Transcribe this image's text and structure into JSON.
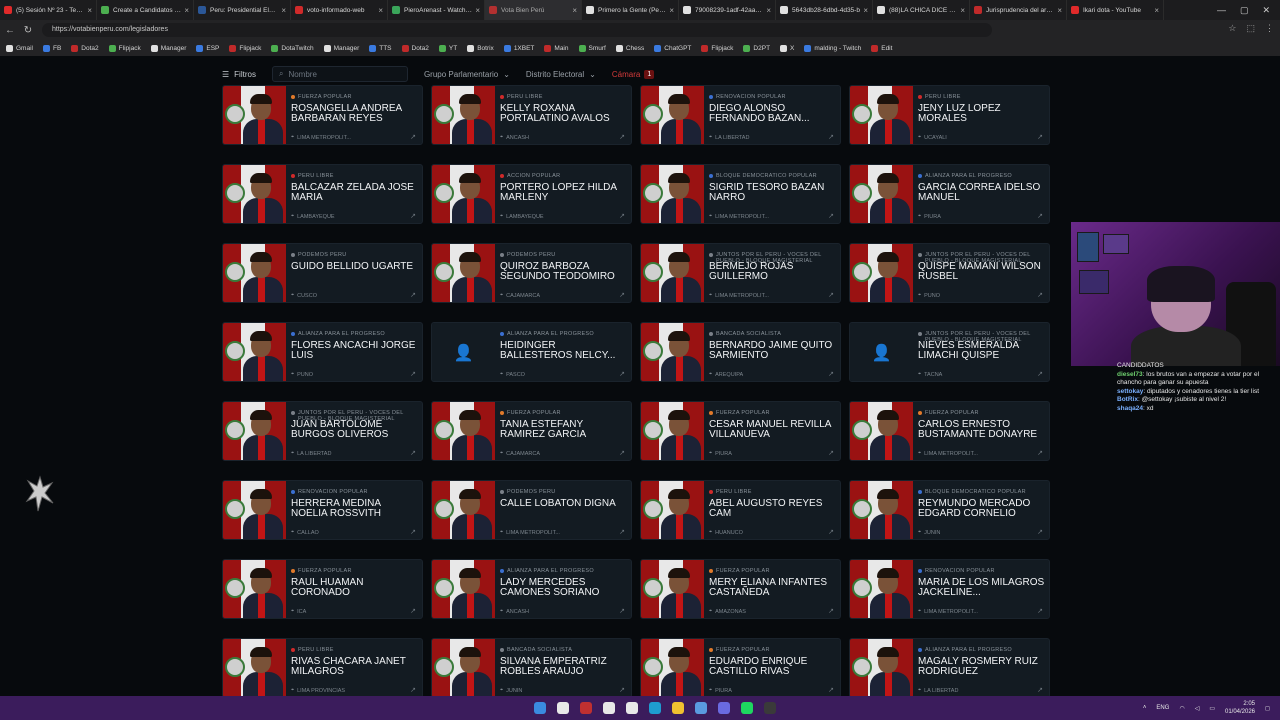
{
  "browser": {
    "tabs": [
      {
        "title": "(5) Sesión Nº 23 - Testimo",
        "color": "#e02a2a"
      },
      {
        "title": "Create a Candidatos Per...",
        "color": "#4caf50"
      },
      {
        "title": "Peru: Presidential Electio",
        "color": "#2b5797"
      },
      {
        "title": "voto-informado-web",
        "color": "#d02a2a"
      },
      {
        "title": "PieroArenast - Watch the",
        "color": "#3aa55a"
      },
      {
        "title": "Vota Bien Perú",
        "color": "#b23030",
        "active": true
      },
      {
        "title": "Primero la Gente (Perú) -",
        "color": "#e0e0e0"
      },
      {
        "title": "79008239-1adf-42aa-aa6",
        "color": "#e0e0e0"
      },
      {
        "title": "5643db28-6dbd-4d35-b",
        "color": "#e0e0e0"
      },
      {
        "title": "(88)LA CHICA DICE QUE",
        "color": "#e0e0e0"
      },
      {
        "title": "Jurisprudencia del artícul",
        "color": "#c02a2a"
      },
      {
        "title": "Ikari dota - YouTube",
        "color": "#e02a2a"
      }
    ],
    "url": "https://votabienperu.com/legisladores",
    "bookmarks": [
      "Gmail",
      "FB",
      "Dota2",
      "Flipjack",
      "Manager",
      "ESP",
      "Flipjack",
      "DotaTwitch",
      "Manager",
      "TTS",
      "Dota2",
      "YT",
      "Botrix",
      "1XBET",
      "Main",
      "Smurf",
      "Chess",
      "ChatGPT",
      "Flipjack",
      "D2PT",
      "X",
      "malding - Twitch",
      "Edit"
    ]
  },
  "filters": {
    "filter_label": "Filtros",
    "search_placeholder": "Nombre",
    "group_label": "Grupo Parlamentario",
    "district_label": "Distrito Electoral",
    "chamber_label": "Cámara",
    "chamber_count": "1"
  },
  "cards": [
    {
      "party": "FUERZA POPULAR",
      "name": "ROSANGELLA ANDREA BARBARAN REYES",
      "region": "LIMA METROPOLIT...",
      "color": "#e07a2a",
      "photo": true
    },
    {
      "party": "PERU LIBRE",
      "name": "KELLY ROXANA PORTALATINO AVALOS",
      "region": "ANCASH",
      "color": "#d02a2a",
      "photo": true
    },
    {
      "party": "RENOVACION POPULAR",
      "name": "DIEGO ALONSO FERNANDO BAZAN...",
      "region": "LA LIBERTAD",
      "color": "#3a6fd0",
      "photo": true
    },
    {
      "party": "PERU LIBRE",
      "name": "JENY LUZ LOPEZ MORALES",
      "region": "UCAYALI",
      "color": "#d02a2a",
      "photo": true
    },
    {
      "party": "PERU LIBRE",
      "name": "BALCAZAR ZELADA JOSE MARIA",
      "region": "LAMBAYEQUE",
      "color": "#d02a2a",
      "photo": true
    },
    {
      "party": "ACCION POPULAR",
      "name": "PORTERO LOPEZ HILDA MARLENY",
      "region": "LAMBAYEQUE",
      "color": "#d02a2a",
      "photo": true
    },
    {
      "party": "BLOQUE DEMOCRATICO POPULAR",
      "name": "SIGRID TESORO BAZAN NARRO",
      "region": "LIMA METROPOLIT...",
      "color": "#3a6fd0",
      "photo": true
    },
    {
      "party": "ALIANZA PARA EL PROGRESO",
      "name": "GARCIA CORREA IDELSO MANUEL",
      "region": "PIURA",
      "color": "#3a6fd0",
      "photo": true
    },
    {
      "party": "PODEMOS PERU",
      "name": "GUIDO BELLIDO UGARTE",
      "region": "CUSCO",
      "color": "#7a8088",
      "photo": true
    },
    {
      "party": "PODEMOS PERU",
      "name": "QUIROZ BARBOZA SEGUNDO TEODOMIRO",
      "region": "CAJAMARCA",
      "color": "#7a8088",
      "photo": true
    },
    {
      "party": "JUNTOS POR EL PERU - VOCES DEL PUEBLO - BLOQUE MAGISTERIAL",
      "name": "BERMEJO ROJAS GUILLERMO",
      "region": "LIMA METROPOLIT...",
      "color": "#7a8088",
      "photo": true
    },
    {
      "party": "JUNTOS POR EL PERU - VOCES DEL PUEBLO - BLOQUE MAGISTERIAL",
      "name": "QUISPE MAMANI WILSON RUSBEL",
      "region": "PUNO",
      "color": "#7a8088",
      "photo": true
    },
    {
      "party": "ALIANZA PARA EL PROGRESO",
      "name": "FLORES ANCACHI JORGE LUIS",
      "region": "PUNO",
      "color": "#3a6fd0",
      "photo": true
    },
    {
      "party": "ALIANZA PARA EL PROGRESO",
      "name": "HEIDINGER BALLESTEROS NELCY...",
      "region": "PASCO",
      "color": "#3a6fd0",
      "photo": false
    },
    {
      "party": "BANCADA SOCIALISTA",
      "name": "BERNARDO JAIME QUITO SARMIENTO",
      "region": "AREQUIPA",
      "color": "#7a8088",
      "photo": true
    },
    {
      "party": "JUNTOS POR EL PERU - VOCES DEL PUEBLO - BLOQUE MAGISTERIAL",
      "name": "NIEVES ESMERALDA LIMACHI QUISPE",
      "region": "TACNA",
      "color": "#7a8088",
      "photo": false
    },
    {
      "party": "JUNTOS POR EL PERU - VOCES DEL PUEBLO - BLOQUE MAGISTERIAL",
      "name": "JUAN BARTOLOME BURGOS OLIVEROS",
      "region": "LA LIBERTAD",
      "color": "#7a8088",
      "photo": true
    },
    {
      "party": "FUERZA POPULAR",
      "name": "TANIA ESTEFANY RAMIREZ GARCIA",
      "region": "CAJAMARCA",
      "color": "#e07a2a",
      "photo": true
    },
    {
      "party": "FUERZA POPULAR",
      "name": "CESAR MANUEL REVILLA VILLANUEVA",
      "region": "PIURA",
      "color": "#e07a2a",
      "photo": true
    },
    {
      "party": "FUERZA POPULAR",
      "name": "CARLOS ERNESTO BUSTAMANTE DONAYRE",
      "region": "LIMA METROPOLIT...",
      "color": "#e07a2a",
      "photo": true
    },
    {
      "party": "RENOVACION POPULAR",
      "name": "HERRERA MEDINA NOELIA ROSSVITH",
      "region": "CALLAO",
      "color": "#3a6fd0",
      "photo": true
    },
    {
      "party": "PODEMOS PERU",
      "name": "CALLE LOBATON DIGNA",
      "region": "LIMA METROPOLIT...",
      "color": "#7a8088",
      "photo": true
    },
    {
      "party": "PERU LIBRE",
      "name": "ABEL AUGUSTO REYES CAM",
      "region": "HUANUCO",
      "color": "#d02a2a",
      "photo": true
    },
    {
      "party": "BLOQUE DEMOCRATICO POPULAR",
      "name": "REYMUNDO MERCADO EDGARD CORNELIO",
      "region": "JUNIN",
      "color": "#3a6fd0",
      "photo": true
    },
    {
      "party": "FUERZA POPULAR",
      "name": "RAUL HUAMAN CORONADO",
      "region": "ICA",
      "color": "#e07a2a",
      "photo": true
    },
    {
      "party": "ALIANZA PARA EL PROGRESO",
      "name": "LADY MERCEDES CAMONES SORIANO",
      "region": "ANCASH",
      "color": "#3a6fd0",
      "photo": true
    },
    {
      "party": "FUERZA POPULAR",
      "name": "MERY ELIANA INFANTES CASTAÑEDA",
      "region": "AMAZONAS",
      "color": "#e07a2a",
      "photo": true
    },
    {
      "party": "RENOVACION POPULAR",
      "name": "MARIA DE LOS MILAGROS JACKELINE...",
      "region": "LIMA METROPOLIT...",
      "color": "#3a6fd0",
      "photo": true
    },
    {
      "party": "PERU LIBRE",
      "name": "RIVAS CHACARA JANET MILAGROS",
      "region": "LIMA PROVINCIAS",
      "color": "#d02a2a",
      "photo": true
    },
    {
      "party": "BANCADA SOCIALISTA",
      "name": "SILVANA EMPERATRIZ ROBLES ARAUJO",
      "region": "JUNIN",
      "color": "#7a8088",
      "photo": true
    },
    {
      "party": "FUERZA POPULAR",
      "name": "EDUARDO ENRIQUE CASTILLO RIVAS",
      "region": "PIURA",
      "color": "#e07a2a",
      "photo": true
    },
    {
      "party": "ALIANZA PARA EL PROGRESO",
      "name": "MAGALY ROSMERY RUIZ RODRIGUEZ",
      "region": "LA LIBERTAD",
      "color": "#3a6fd0",
      "photo": true
    }
  ],
  "chat": [
    {
      "user": "",
      "text": "CANDIDDATOS",
      "color": "#e8e8e8"
    },
    {
      "user": "diesel73",
      "text": ": los brutos van a empezar a votar por el chancho para ganar su apuesta",
      "color": "#6fd06f"
    },
    {
      "user": "settokay",
      "text": ": diputados y cenadores tienes la tier list",
      "color": "#7ab0ff"
    },
    {
      "user": "BotRix",
      "text": ": @settokay ¡subiste al nivel 2!",
      "color": "#7ab0ff"
    },
    {
      "user": "shaqa24",
      "text": ": xd",
      "color": "#7ab0ff"
    }
  ],
  "taskbar": {
    "lang": "ENG",
    "time": "2:05",
    "date": "01/04/2026",
    "icon_colors": [
      "#3a8be0",
      "#e8e8e8",
      "#c03030",
      "#e8e8e8",
      "#e8e8e8",
      "#1e9cd0",
      "#f0c030",
      "#5a9ae0",
      "#6a6ae0",
      "#1ed760",
      "#3a3a3a"
    ]
  }
}
